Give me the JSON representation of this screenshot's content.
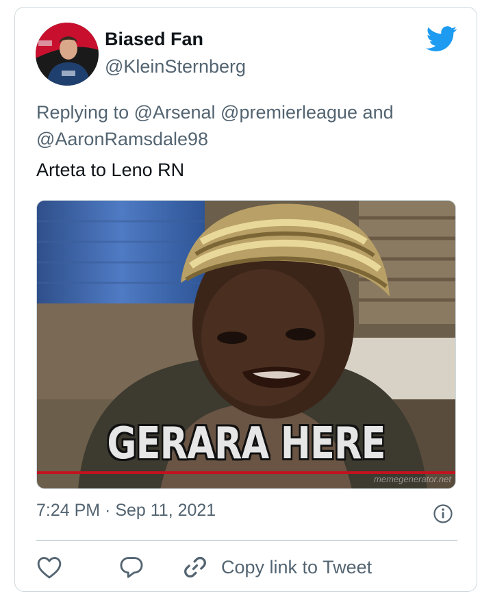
{
  "tweet": {
    "display_name": "Biased Fan",
    "handle": "@KleinSternberg",
    "reply_line": "Replying to @Arsenal @premierleague and @AaronRamsdale98",
    "text": "Arteta to Leno RN",
    "timestamp": "7:24 PM · Sep 11, 2021"
  },
  "media": {
    "caption": "GERARA HERE",
    "watermark": "memegenerator.net"
  },
  "actions": {
    "copy_link_label": "Copy link to Tweet"
  },
  "icons": [
    "twitter-bird-icon",
    "info-icon",
    "heart-icon",
    "reply-bubble-icon",
    "link-icon"
  ],
  "colors": {
    "brand": "#1d9bf0",
    "secondary_text": "#536471",
    "border": "#cfd9de"
  }
}
